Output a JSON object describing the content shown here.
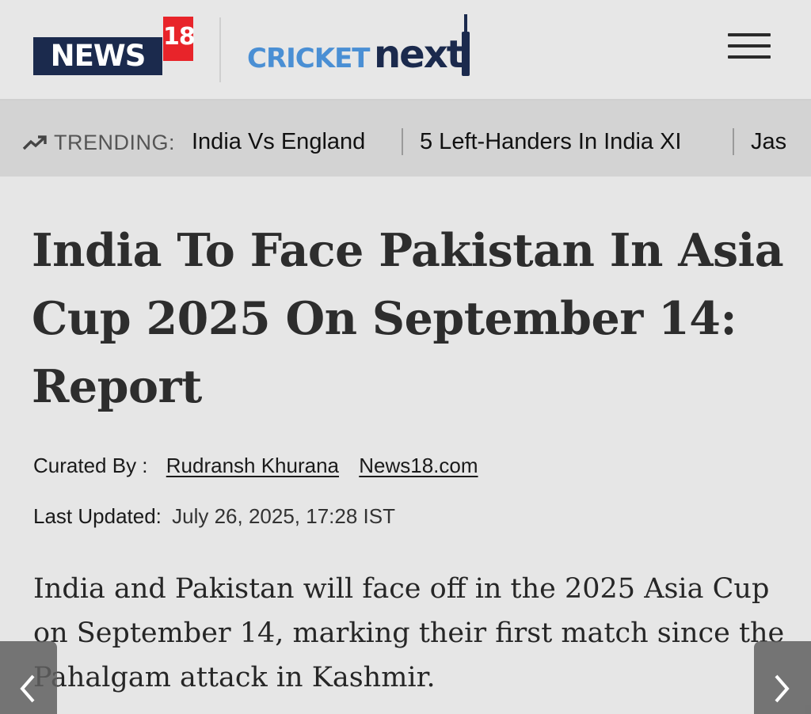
{
  "header": {
    "logo_news": "NEWS",
    "logo_num": "18",
    "cricket_logo_a": "CRICKET",
    "cricket_logo_b": "next",
    "menu_icon": "hamburger-menu-icon"
  },
  "trending": {
    "icon": "trending-up-icon",
    "label": "TRENDING:",
    "items": [
      "India Vs England",
      "5 Left-Handers In India XI",
      "Jas"
    ]
  },
  "article": {
    "headline": "India To Face Pakistan In Asia Cup 2025 On September 14: Report",
    "curated_by_label": "Curated By :",
    "author": "Rudransh Khurana",
    "source": "News18.com",
    "updated_label": "Last Updated:",
    "updated_value": "July 26, 2025, 17:28 IST",
    "lead": "India and Pakistan will face off in the 2025 Asia Cup on September 14, marking their first match since the Pahalgam attack in Kashmir."
  },
  "nav": {
    "prev_icon": "chevron-left-icon",
    "next_icon": "chevron-right-icon"
  },
  "colors": {
    "news18_navy": "#1b2a4d",
    "news18_red": "#e8242a",
    "cricket_blue": "#4a8fd4"
  }
}
